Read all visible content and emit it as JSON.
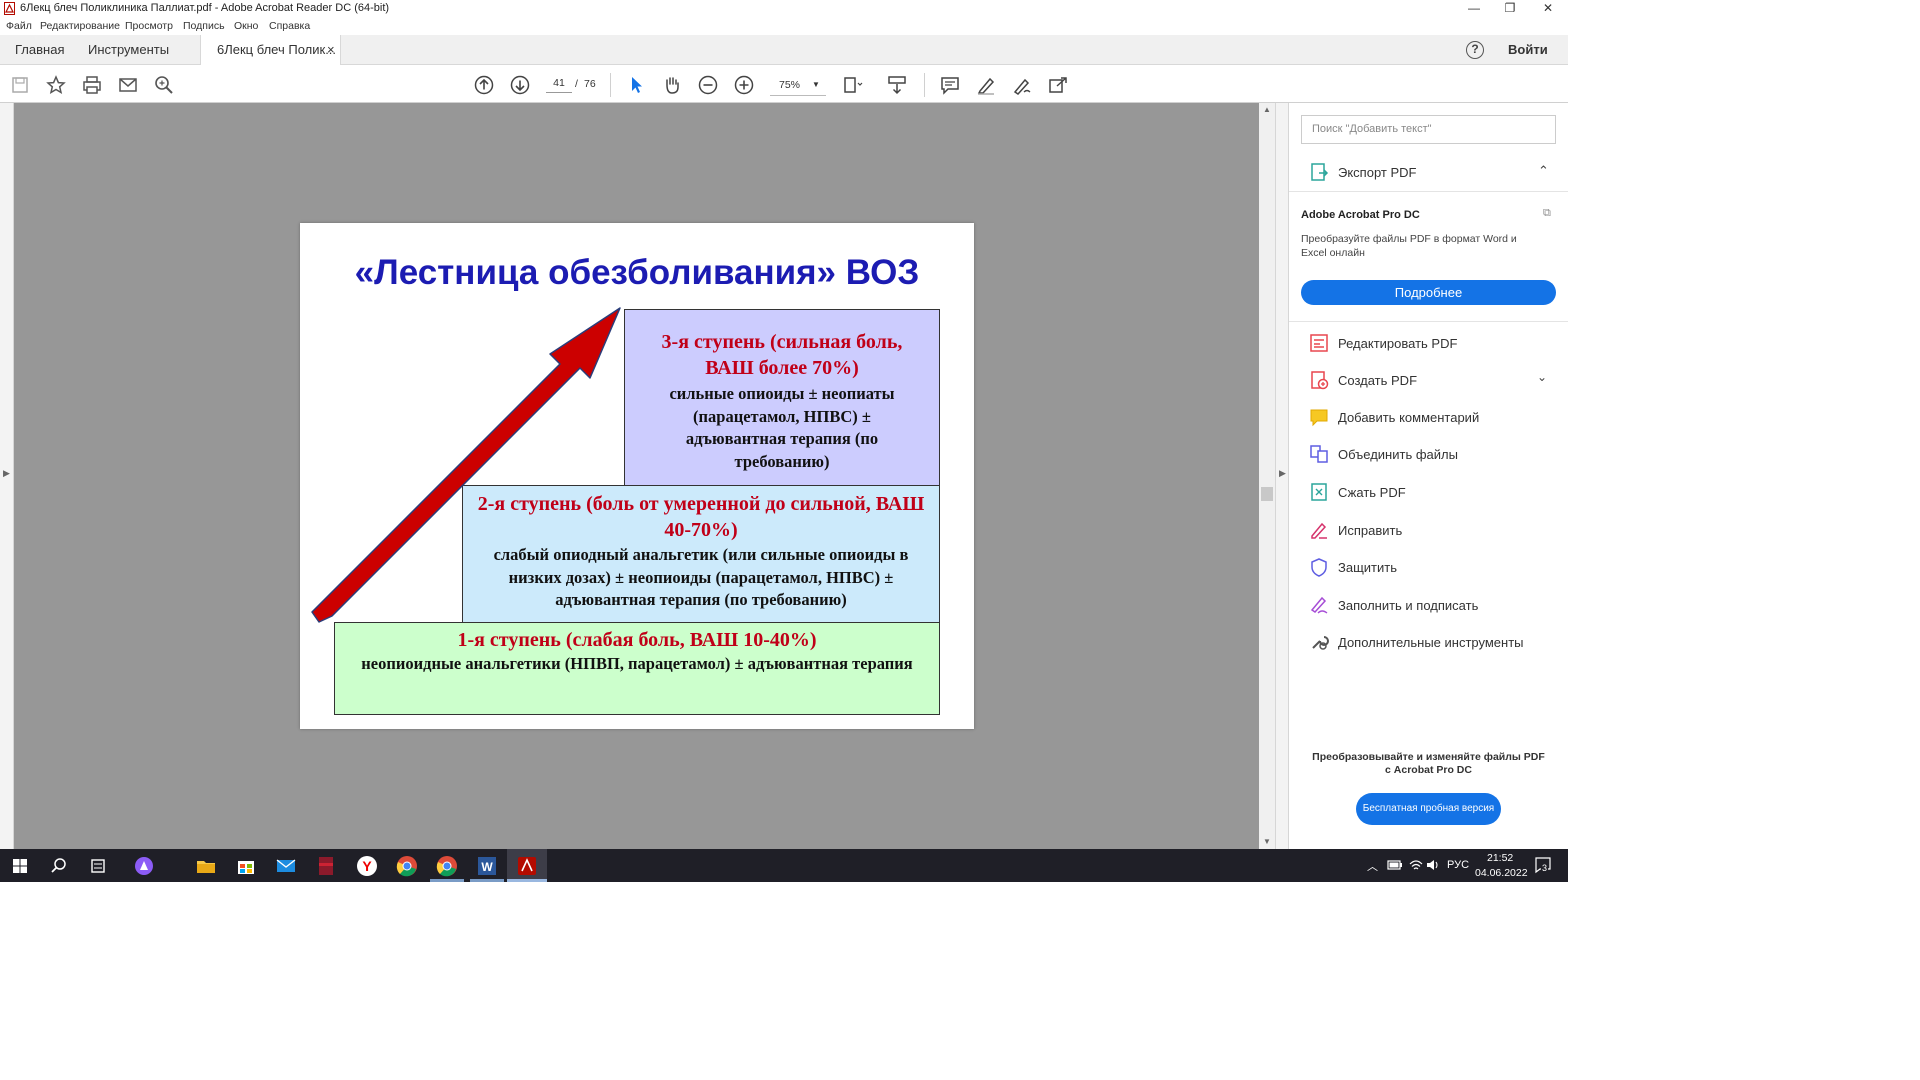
{
  "window": {
    "title": "6Лекц блеч Поликлиника Паллиат.pdf - Adobe Acrobat Reader DC (64-bit)"
  },
  "menu": [
    "Файл",
    "Редактирование",
    "Просмотр",
    "Подпись",
    "Окно",
    "Справка"
  ],
  "tabs": {
    "home": "Главная",
    "tools": "Инструменты",
    "doc": "6Лекц блеч Полик...",
    "close": "×",
    "help": "?",
    "signin": "Войти"
  },
  "toolbar": {
    "page_current": "41",
    "page_sep": "/",
    "page_total": "76",
    "zoom": "75%"
  },
  "slide": {
    "title": "«Лестница обезболивания» ВОЗ",
    "step3": {
      "heading": "3-я ступень (сильная боль, ВАШ более 70%)",
      "body": "сильные опиоиды ± неопиаты (парацетамол, НПВС) ± адъювантная терапия (по требованию)"
    },
    "step2": {
      "heading": "2-я ступень (боль от умеренной до сильной, ВАШ 40-70%)",
      "body": "слабый опиодный анальгетик (или сильные опиоиды в низких дозах) ± неопиоиды (парацетамол, НПВС) ± адъювантная терапия (по требованию)"
    },
    "step1": {
      "heading": "1-я ступень (слабая боль, ВАШ 10-40%)",
      "body": "неопиоидные анальгетики (НПВП, парацетамол) ± адъювантная терапия"
    }
  },
  "right_panel": {
    "search_placeholder": "Поиск \"Добавить текст\"",
    "export_pdf": "Экспорт PDF",
    "promo_title": "Adobe Acrobat Pro DC",
    "promo_text": "Преобразуйте файлы PDF в формат Word и Excel онлайн",
    "promo_button": "Подробнее",
    "tools": [
      "Редактировать PDF",
      "Создать PDF",
      "Добавить комментарий",
      "Объединить файлы",
      "Сжать PDF",
      "Исправить",
      "Защитить",
      "Заполнить и подписать",
      "Дополнительные инструменты"
    ],
    "footer_text": "Преобразовывайте и изменяйте файлы PDF с Acrobat Pro DC",
    "trial_button": "Бесплатная пробная версия"
  },
  "taskbar": {
    "lang": "РУС",
    "time": "21:52",
    "date": "04.06.2022",
    "notifications": "3"
  },
  "colors": {
    "accent_blue": "#1473e6",
    "slide_title": "#1c1cb2",
    "step_heading": "#c00018",
    "step3_bg": "#ccccfe",
    "step2_bg": "#cceafb",
    "step1_bg": "#ccffcc",
    "arrow": "#cc0000"
  }
}
